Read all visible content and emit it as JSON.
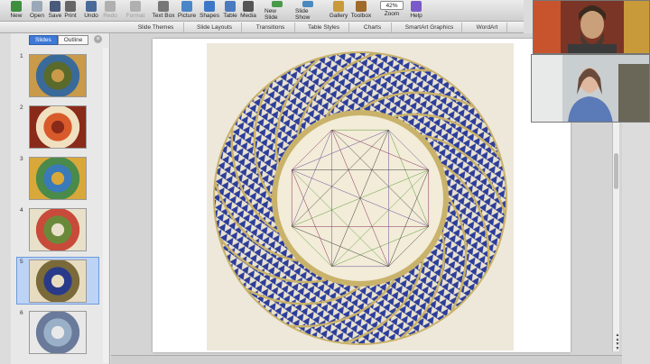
{
  "toolbar": {
    "items": [
      {
        "label": "New",
        "icon": "new-doc-icon",
        "color": "#3d8f3d"
      },
      {
        "label": "Open",
        "icon": "folder-icon",
        "color": "#9aa8b8"
      },
      {
        "label": "Save",
        "icon": "save-icon",
        "color": "#4a5a7a"
      },
      {
        "label": "Print",
        "icon": "printer-icon",
        "color": "#666666"
      },
      {
        "label": "Undo",
        "icon": "undo-icon",
        "color": "#4a6a9a"
      },
      {
        "label": "Redo",
        "icon": "redo-icon",
        "color": "#b0b0b0"
      },
      {
        "label": "Format",
        "icon": "format-brush-icon",
        "color": "#b0b0b0"
      },
      {
        "label": "Text Box",
        "icon": "textbox-icon",
        "color": "#777777"
      },
      {
        "label": "Picture",
        "icon": "picture-icon",
        "color": "#4a86c8"
      },
      {
        "label": "Shapes",
        "icon": "shapes-icon",
        "color": "#3d78c8"
      },
      {
        "label": "Table",
        "icon": "table-icon",
        "color": "#4a7ac0"
      },
      {
        "label": "Media",
        "icon": "media-icon",
        "color": "#555555"
      },
      {
        "label": "New Slide",
        "icon": "new-slide-icon",
        "color": "#4a9a4a"
      },
      {
        "label": "Slide Show",
        "icon": "slideshow-icon",
        "color": "#4a8ac0"
      },
      {
        "label": "Gallery",
        "icon": "gallery-icon",
        "color": "#c89a3a"
      },
      {
        "label": "Toolbox",
        "icon": "toolbox-icon",
        "color": "#a06a2a"
      },
      {
        "label": "Zoom",
        "icon": "zoom-icon",
        "color": "#ffffff"
      },
      {
        "label": "Help",
        "icon": "help-icon",
        "color": "#7a5ac8"
      }
    ],
    "zoom_value": "42%"
  },
  "ribbon": {
    "tabs": [
      "Slide Themes",
      "Slide Layouts",
      "Transitions",
      "Table Styles",
      "Charts",
      "SmartArt Graphics",
      "WordArt"
    ]
  },
  "slides_pane": {
    "tab_slides": "Slides",
    "tab_outline": "Outline",
    "selected_slide": 5,
    "slides": [
      {
        "number": "1",
        "colors": [
          "#5a6a2a",
          "#c89a4a",
          "#3a6a9a"
        ]
      },
      {
        "number": "2",
        "colors": [
          "#d85a2a",
          "#8a2a1a",
          "#f0e0c0"
        ]
      },
      {
        "number": "3",
        "colors": [
          "#3a7ab8",
          "#d8a83a",
          "#4a8a4a"
        ]
      },
      {
        "number": "4",
        "colors": [
          "#6a8a3a",
          "#e8e0c8",
          "#c84a3a"
        ]
      },
      {
        "number": "5",
        "colors": [
          "#2a3a8a",
          "#e8dcc0",
          "#7a6a3a"
        ]
      },
      {
        "number": "6",
        "colors": [
          "#9ab0c8",
          "#e8e8e8",
          "#6a7a9a"
        ]
      }
    ]
  },
  "colors": {
    "mandala_blue": "#2c3d9a",
    "mandala_gold": "#c9b26a",
    "center_bg": "#f2ecd8"
  }
}
